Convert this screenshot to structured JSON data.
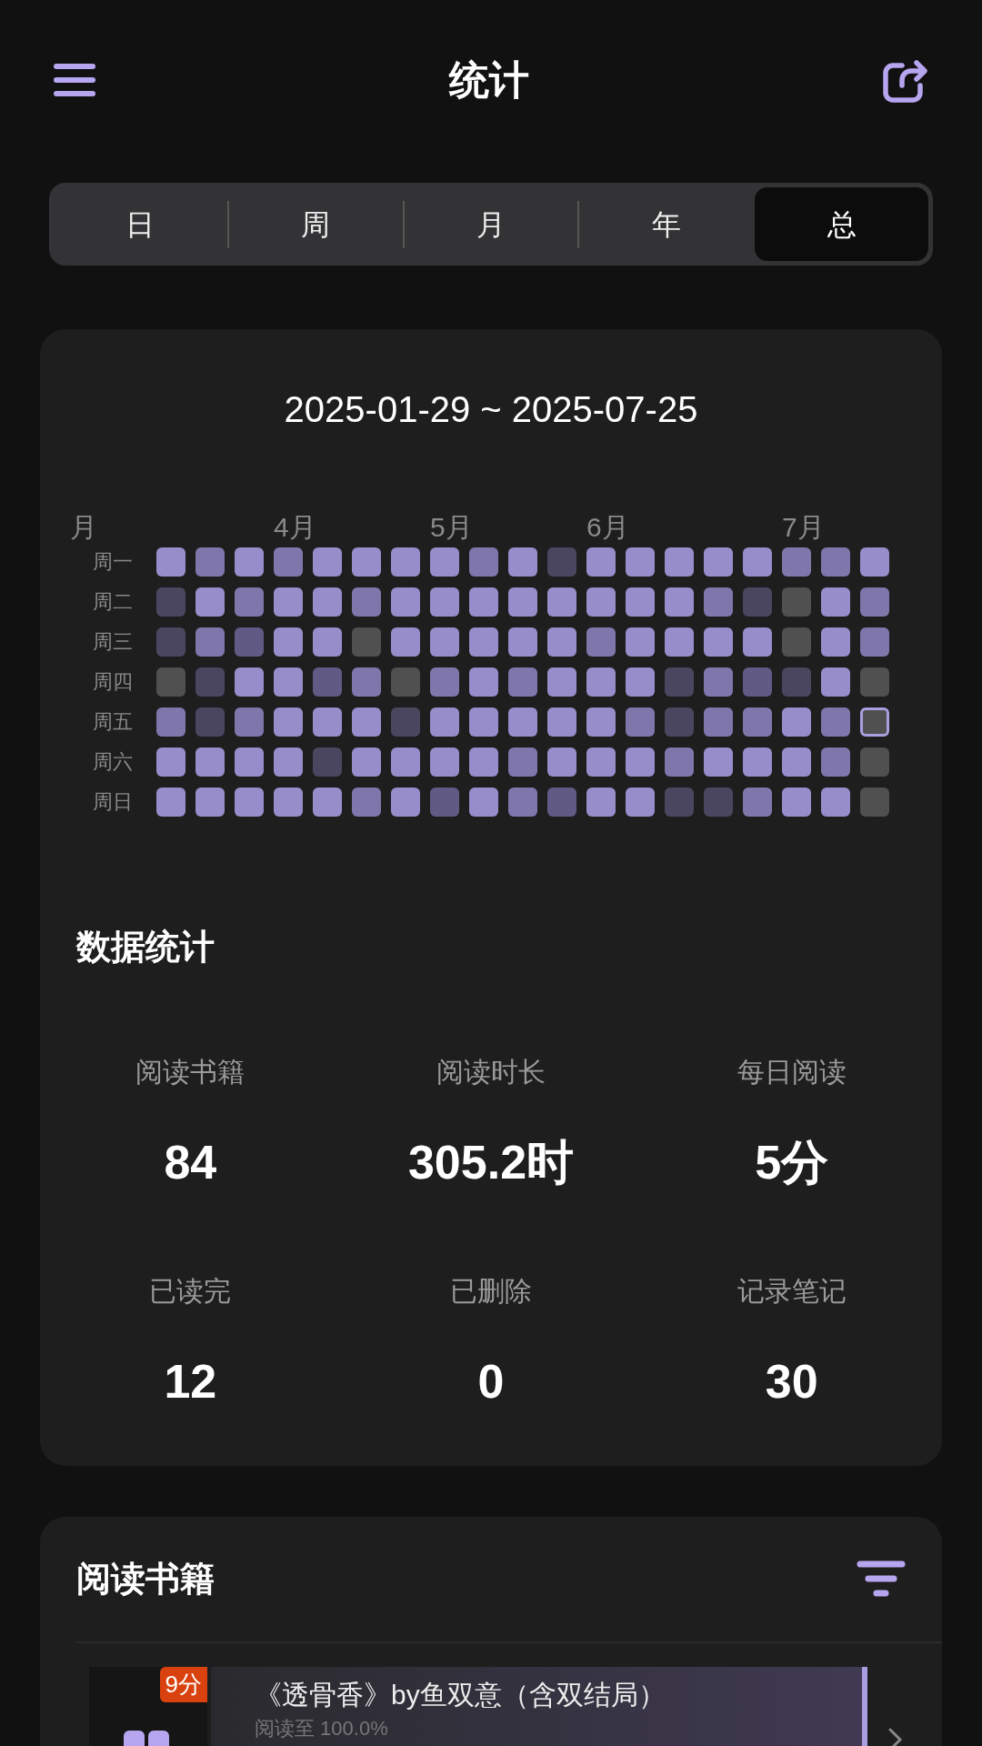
{
  "header": {
    "title": "统计"
  },
  "tabs": [
    {
      "label": "日",
      "selected": false
    },
    {
      "label": "周",
      "selected": false
    },
    {
      "label": "月",
      "selected": false
    },
    {
      "label": "年",
      "selected": false
    },
    {
      "label": "总",
      "selected": true
    }
  ],
  "date_range": "2025-01-29 ~ 2025-07-25",
  "heatmap": {
    "months": [
      "月",
      "4月",
      "5月",
      "6月",
      "7月"
    ],
    "rows": [
      {
        "label": "周一",
        "cells": [
          {
            "color": "#978dcb",
            "selected": false
          },
          {
            "color": "#7f76ab",
            "selected": false
          },
          {
            "color": "#978dcb",
            "selected": false
          },
          {
            "color": "#7f76ab",
            "selected": false
          },
          {
            "color": "#978dcb",
            "selected": false
          },
          {
            "color": "#978dcb",
            "selected": false
          },
          {
            "color": "#978dcb",
            "selected": false
          },
          {
            "color": "#978dcb",
            "selected": false
          },
          {
            "color": "#7f76ab",
            "selected": false
          },
          {
            "color": "#978dcb",
            "selected": false
          },
          {
            "color": "#4a4660",
            "selected": false
          },
          {
            "color": "#978dcb",
            "selected": false
          },
          {
            "color": "#978dcb",
            "selected": false
          },
          {
            "color": "#978dcb",
            "selected": false
          },
          {
            "color": "#978dcb",
            "selected": false
          },
          {
            "color": "#978dcb",
            "selected": false
          },
          {
            "color": "#7f76ab",
            "selected": false
          },
          {
            "color": "#7f76ab",
            "selected": false
          },
          {
            "color": "#978dcb",
            "selected": false
          }
        ]
      },
      {
        "label": "周二",
        "cells": [
          {
            "color": "#4a4660",
            "selected": false
          },
          {
            "color": "#978dcb",
            "selected": false
          },
          {
            "color": "#7f76ab",
            "selected": false
          },
          {
            "color": "#978dcb",
            "selected": false
          },
          {
            "color": "#978dcb",
            "selected": false
          },
          {
            "color": "#7f76ab",
            "selected": false
          },
          {
            "color": "#978dcb",
            "selected": false
          },
          {
            "color": "#978dcb",
            "selected": false
          },
          {
            "color": "#978dcb",
            "selected": false
          },
          {
            "color": "#978dcb",
            "selected": false
          },
          {
            "color": "#978dcb",
            "selected": false
          },
          {
            "color": "#978dcb",
            "selected": false
          },
          {
            "color": "#978dcb",
            "selected": false
          },
          {
            "color": "#978dcb",
            "selected": false
          },
          {
            "color": "#7f76ab",
            "selected": false
          },
          {
            "color": "#4a4660",
            "selected": false
          },
          {
            "color": "#505050",
            "selected": false
          },
          {
            "color": "#978dcb",
            "selected": false
          },
          {
            "color": "#7f76ab",
            "selected": false
          }
        ]
      },
      {
        "label": "周三",
        "cells": [
          {
            "color": "#4a4660",
            "selected": false
          },
          {
            "color": "#7f76ab",
            "selected": false
          },
          {
            "color": "#615a85",
            "selected": false
          },
          {
            "color": "#978dcb",
            "selected": false
          },
          {
            "color": "#978dcb",
            "selected": false
          },
          {
            "color": "#505050",
            "selected": false
          },
          {
            "color": "#978dcb",
            "selected": false
          },
          {
            "color": "#978dcb",
            "selected": false
          },
          {
            "color": "#978dcb",
            "selected": false
          },
          {
            "color": "#978dcb",
            "selected": false
          },
          {
            "color": "#978dcb",
            "selected": false
          },
          {
            "color": "#7f76ab",
            "selected": false
          },
          {
            "color": "#978dcb",
            "selected": false
          },
          {
            "color": "#978dcb",
            "selected": false
          },
          {
            "color": "#978dcb",
            "selected": false
          },
          {
            "color": "#978dcb",
            "selected": false
          },
          {
            "color": "#505050",
            "selected": false
          },
          {
            "color": "#978dcb",
            "selected": false
          },
          {
            "color": "#7f76ab",
            "selected": false
          }
        ]
      },
      {
        "label": "周四",
        "cells": [
          {
            "color": "#505050",
            "selected": false
          },
          {
            "color": "#4a4660",
            "selected": false
          },
          {
            "color": "#978dcb",
            "selected": false
          },
          {
            "color": "#978dcb",
            "selected": false
          },
          {
            "color": "#615a85",
            "selected": false
          },
          {
            "color": "#7f76ab",
            "selected": false
          },
          {
            "color": "#505050",
            "selected": false
          },
          {
            "color": "#7f76ab",
            "selected": false
          },
          {
            "color": "#978dcb",
            "selected": false
          },
          {
            "color": "#7f76ab",
            "selected": false
          },
          {
            "color": "#978dcb",
            "selected": false
          },
          {
            "color": "#978dcb",
            "selected": false
          },
          {
            "color": "#978dcb",
            "selected": false
          },
          {
            "color": "#4a4660",
            "selected": false
          },
          {
            "color": "#7f76ab",
            "selected": false
          },
          {
            "color": "#615a85",
            "selected": false
          },
          {
            "color": "#4a4660",
            "selected": false
          },
          {
            "color": "#978dcb",
            "selected": false
          },
          {
            "color": "#505050",
            "selected": false
          }
        ]
      },
      {
        "label": "周五",
        "cells": [
          {
            "color": "#7f76ab",
            "selected": false
          },
          {
            "color": "#4a4660",
            "selected": false
          },
          {
            "color": "#7f76ab",
            "selected": false
          },
          {
            "color": "#978dcb",
            "selected": false
          },
          {
            "color": "#978dcb",
            "selected": false
          },
          {
            "color": "#978dcb",
            "selected": false
          },
          {
            "color": "#4a4660",
            "selected": false
          },
          {
            "color": "#978dcb",
            "selected": false
          },
          {
            "color": "#978dcb",
            "selected": false
          },
          {
            "color": "#978dcb",
            "selected": false
          },
          {
            "color": "#978dcb",
            "selected": false
          },
          {
            "color": "#978dcb",
            "selected": false
          },
          {
            "color": "#7f76ab",
            "selected": false
          },
          {
            "color": "#4a4660",
            "selected": false
          },
          {
            "color": "#7f76ab",
            "selected": false
          },
          {
            "color": "#7f76ab",
            "selected": false
          },
          {
            "color": "#978dcb",
            "selected": false
          },
          {
            "color": "#7f76ab",
            "selected": false
          },
          {
            "color": "#505050",
            "selected": true
          }
        ]
      },
      {
        "label": "周六",
        "cells": [
          {
            "color": "#978dcb",
            "selected": false
          },
          {
            "color": "#978dcb",
            "selected": false
          },
          {
            "color": "#978dcb",
            "selected": false
          },
          {
            "color": "#978dcb",
            "selected": false
          },
          {
            "color": "#4a4660",
            "selected": false
          },
          {
            "color": "#978dcb",
            "selected": false
          },
          {
            "color": "#978dcb",
            "selected": false
          },
          {
            "color": "#978dcb",
            "selected": false
          },
          {
            "color": "#978dcb",
            "selected": false
          },
          {
            "color": "#7f76ab",
            "selected": false
          },
          {
            "color": "#978dcb",
            "selected": false
          },
          {
            "color": "#978dcb",
            "selected": false
          },
          {
            "color": "#978dcb",
            "selected": false
          },
          {
            "color": "#7f76ab",
            "selected": false
          },
          {
            "color": "#978dcb",
            "selected": false
          },
          {
            "color": "#978dcb",
            "selected": false
          },
          {
            "color": "#978dcb",
            "selected": false
          },
          {
            "color": "#7f76ab",
            "selected": false
          },
          {
            "color": "#505050",
            "selected": false
          }
        ]
      },
      {
        "label": "周日",
        "cells": [
          {
            "color": "#978dcb",
            "selected": false
          },
          {
            "color": "#978dcb",
            "selected": false
          },
          {
            "color": "#978dcb",
            "selected": false
          },
          {
            "color": "#978dcb",
            "selected": false
          },
          {
            "color": "#978dcb",
            "selected": false
          },
          {
            "color": "#7f76ab",
            "selected": false
          },
          {
            "color": "#978dcb",
            "selected": false
          },
          {
            "color": "#615a85",
            "selected": false
          },
          {
            "color": "#978dcb",
            "selected": false
          },
          {
            "color": "#7f76ab",
            "selected": false
          },
          {
            "color": "#615a85",
            "selected": false
          },
          {
            "color": "#978dcb",
            "selected": false
          },
          {
            "color": "#978dcb",
            "selected": false
          },
          {
            "color": "#4a4660",
            "selected": false
          },
          {
            "color": "#4a4660",
            "selected": false
          },
          {
            "color": "#7f76ab",
            "selected": false
          },
          {
            "color": "#978dcb",
            "selected": false
          },
          {
            "color": "#978dcb",
            "selected": false
          },
          {
            "color": "#505050",
            "selected": false
          }
        ]
      }
    ]
  },
  "stats": {
    "title": "数据统计",
    "items": [
      {
        "label": "阅读书籍",
        "value": "84"
      },
      {
        "label": "阅读时长",
        "value": "305.2时"
      },
      {
        "label": "每日阅读",
        "value": "5分"
      },
      {
        "label": "已读完",
        "value": "12"
      },
      {
        "label": "已删除",
        "value": "0"
      },
      {
        "label": "记录笔记",
        "value": "30"
      }
    ]
  },
  "books": {
    "title": "阅读书籍",
    "items": [
      {
        "badge": "9分",
        "title": "《透骨香》by鱼双意（含双结局）",
        "progress": "阅读至 100.0%"
      }
    ]
  }
}
